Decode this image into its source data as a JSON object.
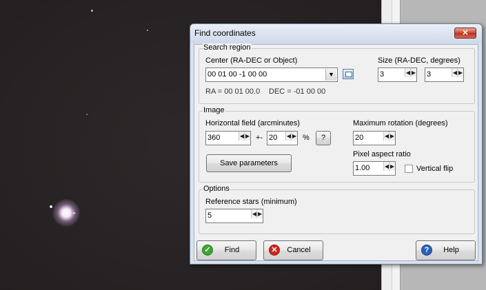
{
  "dialog": {
    "title": "Find coordinates",
    "close_glyph": "✕",
    "search_region": {
      "group_label": "Search region",
      "center_label": "Center (RA-DEC or Object)",
      "center_value": "00 01 00 -1 00 00",
      "size_label": "Size (RA-DEC, degrees)",
      "size_ra": "3",
      "size_dec": "3",
      "parsed_ra": "RA = 00 01 00.0",
      "parsed_dec": "DEC = -01 00 00"
    },
    "image": {
      "group_label": "Image",
      "hfield_label": "Horizontal field (arcminutes)",
      "hfield_value": "360",
      "tolerance_prefix": "+-",
      "tolerance_value": "20",
      "percent_sign": "%",
      "help_q": "?",
      "max_rotation_label": "Maximum rotation (degrees)",
      "max_rotation_value": "20",
      "save_params_label": "Save parameters",
      "pixel_aspect_label": "Pixel aspect ratio",
      "pixel_aspect_value": "1.00",
      "vertical_flip_label": "Vertical flip",
      "vertical_flip_checked": false
    },
    "options": {
      "group_label": "Options",
      "ref_stars_label": "Reference stars (minimum)",
      "ref_stars_value": "5"
    },
    "buttons": {
      "find": "Find",
      "cancel": "Cancel",
      "help": "Help"
    },
    "icons": {
      "find": "check-icon",
      "cancel": "cancel-icon",
      "help": "help-icon",
      "browse": "browse-icon"
    },
    "colors": {
      "find_icon": "#3fa535",
      "cancel_icon": "#d0261b",
      "help_icon": "#2b62b8"
    }
  }
}
